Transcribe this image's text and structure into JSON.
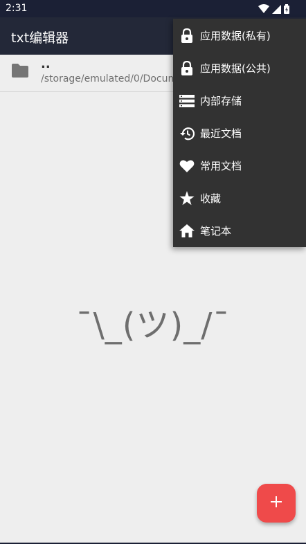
{
  "status_bar": {
    "time": "2:31"
  },
  "app_bar": {
    "title": "txt编辑器"
  },
  "path_row": {
    "name": "..",
    "path": "/storage/emulated/0/Docum"
  },
  "empty_state": {
    "text": "¯\\_(ツ)_/¯"
  },
  "fab": {
    "icon": "plus-icon",
    "color": "#ef4a4a"
  },
  "menu": {
    "items": [
      {
        "label": "应用数据(私有)",
        "icon": "lock-icon"
      },
      {
        "label": "应用数据(公共)",
        "icon": "lock-icon"
      },
      {
        "label": "内部存储",
        "icon": "storage-icon"
      },
      {
        "label": "最近文档",
        "icon": "history-icon"
      },
      {
        "label": "常用文档",
        "icon": "heart-icon"
      },
      {
        "label": "收藏",
        "icon": "star-icon"
      },
      {
        "label": "笔记本",
        "icon": "home-icon"
      }
    ]
  },
  "colors": {
    "status_bar": "#1b2035",
    "app_bar": "#232838",
    "background": "#eeeeee",
    "menu": "#323232"
  }
}
